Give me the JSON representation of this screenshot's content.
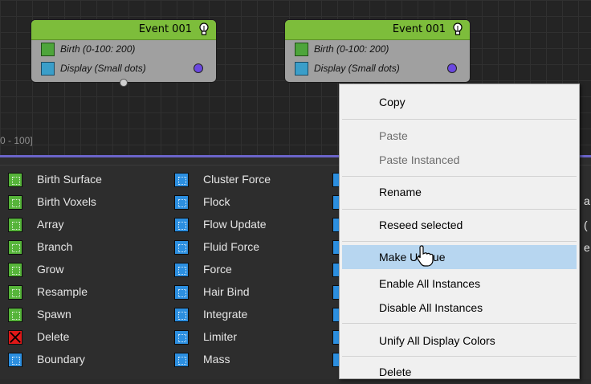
{
  "graph": {
    "nodes": [
      {
        "title": "Event 001",
        "operators": [
          {
            "icon": "birth-icon",
            "label": "Birth (0-100: 200)"
          },
          {
            "icon": "display-icon",
            "label": "Display (Small dots)"
          }
        ]
      },
      {
        "title": "Event 001",
        "operators": [
          {
            "icon": "birth-icon",
            "label": "Birth (0-100: 200)"
          },
          {
            "icon": "display-icon",
            "label": "Display (Small dots)"
          }
        ]
      }
    ],
    "range_label": "0 - 100]"
  },
  "depot": {
    "column1": [
      {
        "icon": "birth-surface-icon",
        "label": "Birth Surface"
      },
      {
        "icon": "birth-voxels-icon",
        "label": "Birth Voxels"
      },
      {
        "icon": "array-icon",
        "label": "Array"
      },
      {
        "icon": "branch-icon",
        "label": "Branch"
      },
      {
        "icon": "grow-icon",
        "label": "Grow"
      },
      {
        "icon": "resample-icon",
        "label": "Resample"
      },
      {
        "icon": "spawn-icon",
        "label": "Spawn"
      },
      {
        "icon": "delete-icon",
        "label": "Delete"
      },
      {
        "icon": "boundary-icon",
        "label": "Boundary"
      }
    ],
    "column2": [
      {
        "icon": "cluster-force-icon",
        "label": "Cluster Force"
      },
      {
        "icon": "flock-icon",
        "label": "Flock"
      },
      {
        "icon": "flow-update-icon",
        "label": "Flow Update"
      },
      {
        "icon": "fluid-force-icon",
        "label": "Fluid Force"
      },
      {
        "icon": "force-icon",
        "label": "Force"
      },
      {
        "icon": "hair-bind-icon",
        "label": "Hair Bind"
      },
      {
        "icon": "integrate-icon",
        "label": "Integrate"
      },
      {
        "icon": "limiter-icon",
        "label": "Limiter"
      },
      {
        "icon": "mass-icon",
        "label": "Mass"
      }
    ],
    "clipped_right": [
      "a",
      "(",
      "e"
    ]
  },
  "context_menu": {
    "items": [
      {
        "label": "Copy",
        "enabled": true
      },
      {
        "label": "Paste",
        "enabled": false
      },
      {
        "label": "Paste Instanced",
        "enabled": false
      },
      {
        "label": "Rename",
        "enabled": true
      },
      {
        "label": "Reseed selected",
        "enabled": true
      },
      {
        "label": "Make Unique",
        "enabled": true,
        "hovered": true
      },
      {
        "label": "Enable All Instances",
        "enabled": true
      },
      {
        "label": "Disable All Instances",
        "enabled": true
      },
      {
        "label": "Unify All Display Colors",
        "enabled": true
      },
      {
        "label": "Delete",
        "enabled": true
      }
    ]
  },
  "colors": {
    "event_header": "#7dbd3b",
    "display_dot": "#6b48e0",
    "divider": "#6b64c9",
    "menu_hover": "#b7d6f0"
  }
}
